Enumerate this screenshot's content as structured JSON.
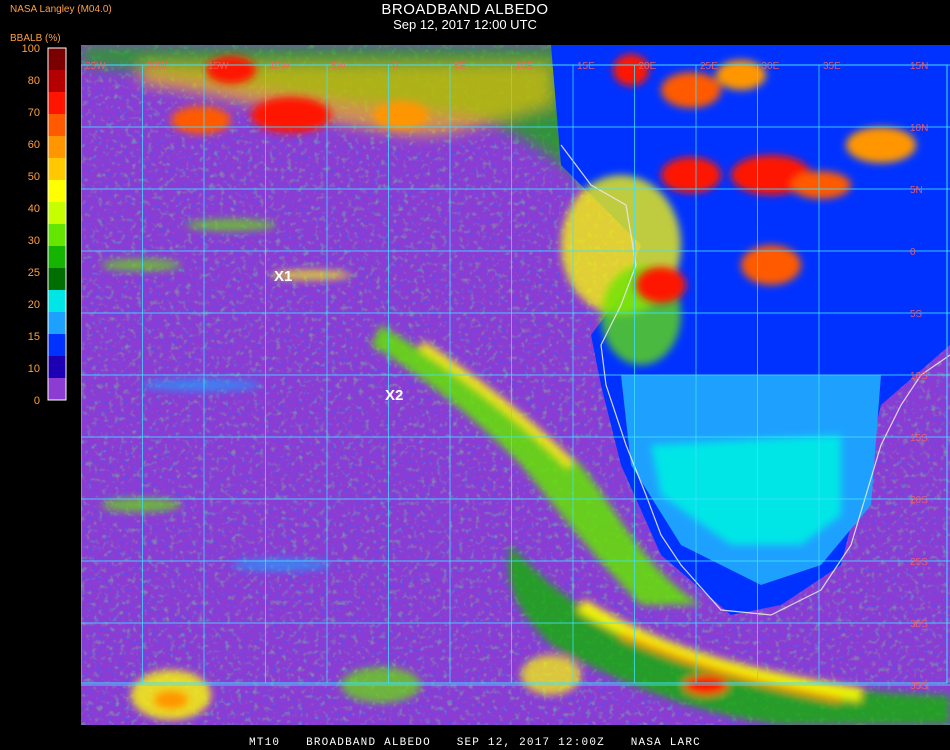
{
  "header": {
    "title": "BROADBAND ALBEDO",
    "datetime": "Sep 12, 2017 12:00 UTC",
    "source": "NASA Langley (M04.0)",
    "units": "BBALB (%)"
  },
  "legend": {
    "ticks": [
      "100",
      "80",
      "70",
      "60",
      "50",
      "40",
      "30",
      "25",
      "20",
      "15",
      "10",
      "0"
    ],
    "bins": [
      {
        "min": 90,
        "max": 100,
        "color": "#7a0000"
      },
      {
        "min": 80,
        "max": 90,
        "color": "#b40000"
      },
      {
        "min": 70,
        "max": 80,
        "color": "#ff1400"
      },
      {
        "min": 65,
        "max": 70,
        "color": "#ff5a00"
      },
      {
        "min": 60,
        "max": 65,
        "color": "#ff9600"
      },
      {
        "min": 55,
        "max": 60,
        "color": "#ffc800"
      },
      {
        "min": 50,
        "max": 55,
        "color": "#ffff00"
      },
      {
        "min": 45,
        "max": 50,
        "color": "#c8ff00"
      },
      {
        "min": 40,
        "max": 45,
        "color": "#64e600"
      },
      {
        "min": 35,
        "max": 40,
        "color": "#14b400"
      },
      {
        "min": 30,
        "max": 35,
        "color": "#006e00"
      },
      {
        "min": 25,
        "max": 30,
        "color": "#00e6e6"
      },
      {
        "min": 20,
        "max": 25,
        "color": "#1ea0ff"
      },
      {
        "min": 15,
        "max": 20,
        "color": "#0032ff"
      },
      {
        "min": 10,
        "max": 15,
        "color": "#1e00b4"
      },
      {
        "min": 0,
        "max": 10,
        "color": "#8c3cd2"
      }
    ]
  },
  "map": {
    "lon_labels": [
      "25W",
      "20W",
      "15W",
      "10W",
      "5W",
      "0",
      "5E",
      "10E",
      "15E",
      "20E",
      "25E",
      "30E",
      "35E"
    ],
    "lat_labels": [
      "15N",
      "10N",
      "5N",
      "0",
      "5S",
      "10S",
      "15S",
      "20S",
      "25S",
      "30S",
      "35S",
      "40S"
    ],
    "markers": [
      {
        "label": "X1",
        "color": "#ffffff"
      },
      {
        "label": "X2",
        "color": "#ffffff"
      }
    ],
    "gridline_color": "#40e0ff"
  },
  "footer": {
    "product": "MT10",
    "name": "BROADBAND ALBEDO",
    "date": "SEP 12, 2017 12:00Z",
    "agency": "NASA LARC"
  }
}
